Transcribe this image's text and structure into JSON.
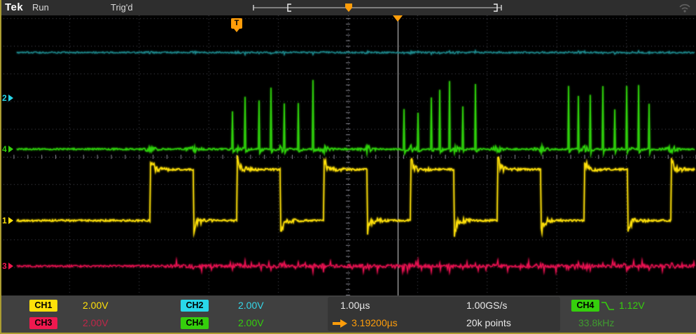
{
  "top_bar": {
    "brand": "Tek",
    "acq_status": "Run",
    "trigger_status": "Trig'd"
  },
  "graticule": {
    "trigger_flag": "T",
    "channel_markers": [
      {
        "label": "2"
      },
      {
        "label": "4"
      },
      {
        "label": "1"
      },
      {
        "label": "3"
      }
    ]
  },
  "readouts": {
    "ch1": {
      "label": "CH1",
      "scale": "2.00V"
    },
    "ch2": {
      "label": "CH2",
      "scale": "2.00V"
    },
    "ch3": {
      "label": "CH3",
      "scale": "2.00V"
    },
    "ch4": {
      "label": "CH4",
      "scale": "2.00V"
    },
    "timebase": "1.00µs",
    "sample_rate": "1.00GS/s",
    "delay": "3.19200µs",
    "record_length": "20k points",
    "trigger_source": "CH4",
    "trigger_level": "1.12V",
    "trigger_frequency": "33.8kHz"
  },
  "colors": {
    "ch1": "#ffe10a",
    "ch2": "#29d8ea",
    "ch3": "#f0194f",
    "ch4": "#35cf0c",
    "accent_orange": "#ff9d0a",
    "grid": "#4e4e58"
  },
  "waveforms": {
    "ch2": {
      "color": "#1e8c90",
      "baseline": 75,
      "noise": 1.1
    },
    "ch3": {
      "color": "#ee1253",
      "baseline": 380,
      "noise": 1.3,
      "active_from": 230
    },
    "ch4": {
      "color": "#2fd30c",
      "baseline": 213,
      "noise": 1.1,
      "burst_groups": [
        332,
        577,
        812
      ],
      "group_span": 118,
      "spike_min": 52,
      "spike_max": 104
    },
    "ch1": {
      "color": "#ffe10a",
      "low": 315,
      "high": 242,
      "first_edge": 215,
      "period": 124,
      "duty": 0.5,
      "overshoot": 16
    }
  }
}
